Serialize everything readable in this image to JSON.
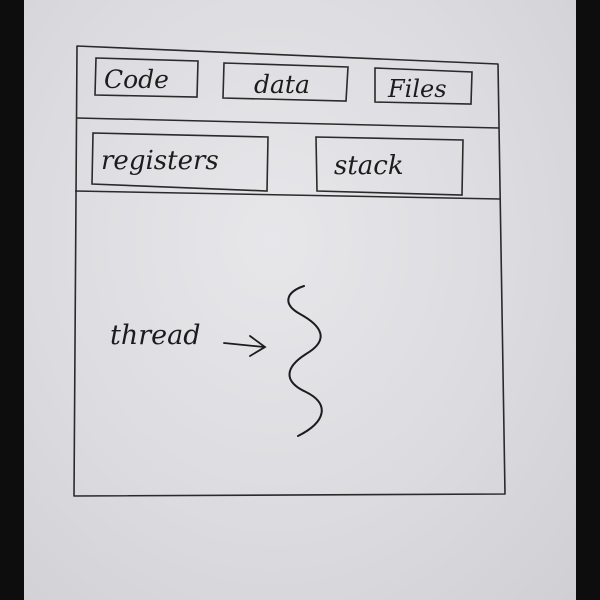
{
  "diagram": {
    "row1_boxes": [
      {
        "label": "Code"
      },
      {
        "label": "data"
      },
      {
        "label": "Files"
      }
    ],
    "row2_boxes": [
      {
        "label": "registers"
      },
      {
        "label": "stack"
      }
    ],
    "thread": {
      "label": "thread",
      "arrow_icon": "right-arrow",
      "squiggle_icon": "wavy-thread-line"
    },
    "ink_color": "#1c1c1c",
    "paper_color": "#e2e2e6",
    "border_color": "#0d0d0d"
  }
}
